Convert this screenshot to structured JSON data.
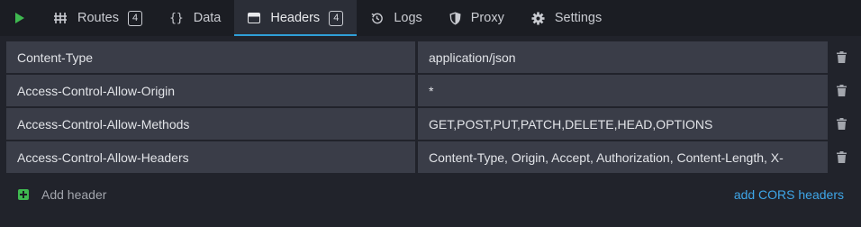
{
  "tabs": [
    {
      "id": "routes",
      "label": "Routes",
      "badge": "4",
      "icon": "routes-icon"
    },
    {
      "id": "data",
      "label": "Data",
      "icon": "braces-icon"
    },
    {
      "id": "headers",
      "label": "Headers",
      "badge": "4",
      "icon": "headers-icon",
      "active": true
    },
    {
      "id": "logs",
      "label": "Logs",
      "icon": "history-icon"
    },
    {
      "id": "proxy",
      "label": "Proxy",
      "icon": "shield-icon"
    },
    {
      "id": "settings",
      "label": "Settings",
      "icon": "gear-icon"
    }
  ],
  "headers": [
    {
      "key": "Content-Type",
      "value": "application/json"
    },
    {
      "key": "Access-Control-Allow-Origin",
      "value": "*"
    },
    {
      "key": "Access-Control-Allow-Methods",
      "value": "GET,POST,PUT,PATCH,DELETE,HEAD,OPTIONS"
    },
    {
      "key": "Access-Control-Allow-Headers",
      "value": "Content-Type, Origin, Accept, Authorization, Content-Length, X-"
    }
  ],
  "footer": {
    "add_header_label": "Add header",
    "cors_link_label": "add CORS headers"
  },
  "colors": {
    "accent": "#2f9fd8",
    "run": "#3fb950",
    "link": "#3ea6e8"
  }
}
